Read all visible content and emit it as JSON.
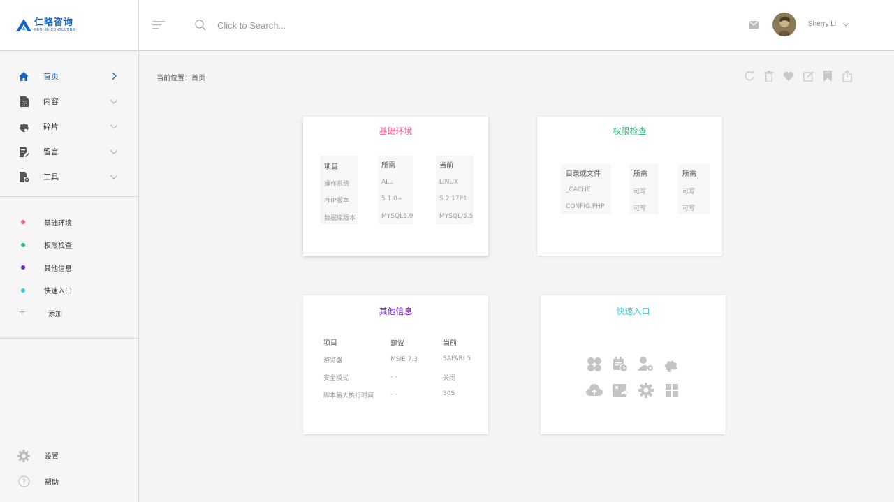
{
  "logo": {
    "name": "仁略咨询",
    "sub": "RENLEE CONSULTING",
    "color": "#1565c0"
  },
  "nav": {
    "items": [
      {
        "label": "首页",
        "icon": "home-icon",
        "active": true
      },
      {
        "label": "内容",
        "icon": "document-icon"
      },
      {
        "label": "碎片",
        "icon": "puzzle-icon"
      },
      {
        "label": "留言",
        "icon": "note-edit-icon"
      },
      {
        "label": "工具",
        "icon": "file-gear-icon"
      }
    ]
  },
  "subnav": {
    "items": [
      {
        "label": "基础环境",
        "color": "#ee5a8c"
      },
      {
        "label": "权限检查",
        "color": "#2bb673"
      },
      {
        "label": "其他信息",
        "color": "#7b1fd8"
      },
      {
        "label": "快速入口",
        "color": "#33ccdd"
      }
    ],
    "add_label": "添加"
  },
  "bottom": {
    "settings": "设置",
    "help": "帮助"
  },
  "header": {
    "search_placeholder": "Click to Search...",
    "user_name": "Sherry Li"
  },
  "breadcrumb": "当前位置：首页",
  "toolbar": [
    "refresh-icon",
    "trash-icon",
    "heart-icon",
    "edit-icon",
    "bookmark-icon",
    "share-icon"
  ],
  "cards": {
    "env": {
      "title": "基础环境",
      "color": "#ee5a8c",
      "headers": [
        "项目",
        "所需",
        "当前"
      ],
      "rows": [
        [
          "操作系统",
          "ALL",
          "LINUX"
        ],
        [
          "PHP版本",
          "5.1.0+",
          "5.2.17P1"
        ],
        [
          "数据库版本",
          "MYSQL5.0",
          "MYSQL/5.5"
        ]
      ]
    },
    "perm": {
      "title": "权限检查",
      "color": "#2bb673",
      "headers": [
        "目录或文件",
        "所需",
        "所需"
      ],
      "rows": [
        [
          "_CACHE",
          "可写",
          "可写"
        ],
        [
          "CONFIG.PHP",
          "可写",
          "可写"
        ]
      ]
    },
    "other": {
      "title": "其他信息",
      "color": "#7b1fd8",
      "headers": [
        "项目",
        "建议",
        "当前"
      ],
      "rows": [
        [
          "游览器",
          "MSIE 7.3",
          "SAFARI 5"
        ],
        [
          "安全模式",
          "- -",
          "关闭"
        ],
        [
          "脚本最大执行时间",
          "- -",
          "30S"
        ]
      ]
    },
    "quick": {
      "title": "快速入口",
      "color": "#33ccdd",
      "icons": [
        "clover-icon",
        "calendar-clock-icon",
        "user-settings-icon",
        "puzzle-icon",
        "cloud-upload-icon",
        "image-reply-icon",
        "gear-icon",
        "grid-icon"
      ]
    }
  }
}
